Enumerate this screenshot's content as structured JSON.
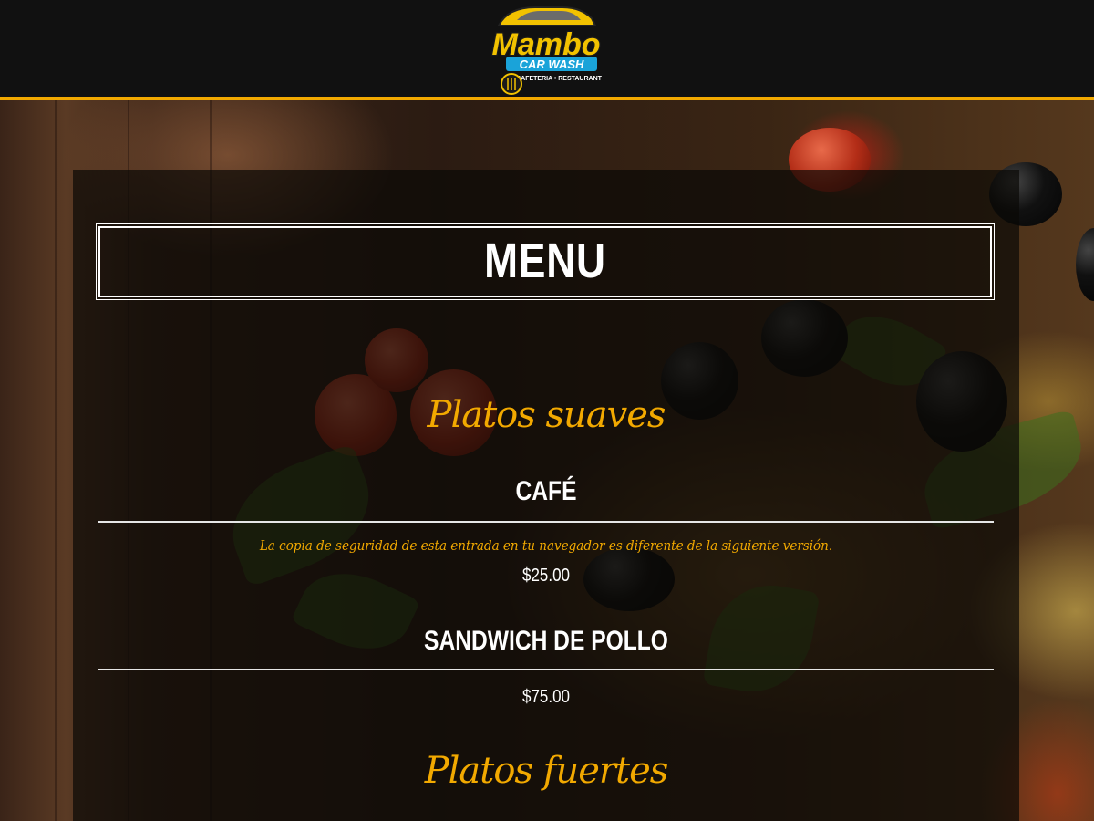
{
  "header": {
    "logo": {
      "line1": "Mambo",
      "line2": "CAR WASH",
      "line3": "CAFETERIA • RESTAURANT",
      "icon": "car-and-fork-knife-icon"
    },
    "accent_color": "#f2a900"
  },
  "menu": {
    "title": "MENU",
    "sections": [
      {
        "title": "Platos suaves",
        "items": [
          {
            "name": "CAFÉ",
            "description": "La copia de seguridad de esta entrada en tu navegador es diferente de la siguiente versión.",
            "price": "$25.00"
          },
          {
            "name": "SANDWICH DE POLLO",
            "description": "",
            "price": "$75.00"
          }
        ]
      },
      {
        "title": "Platos fuertes",
        "items": []
      }
    ]
  }
}
